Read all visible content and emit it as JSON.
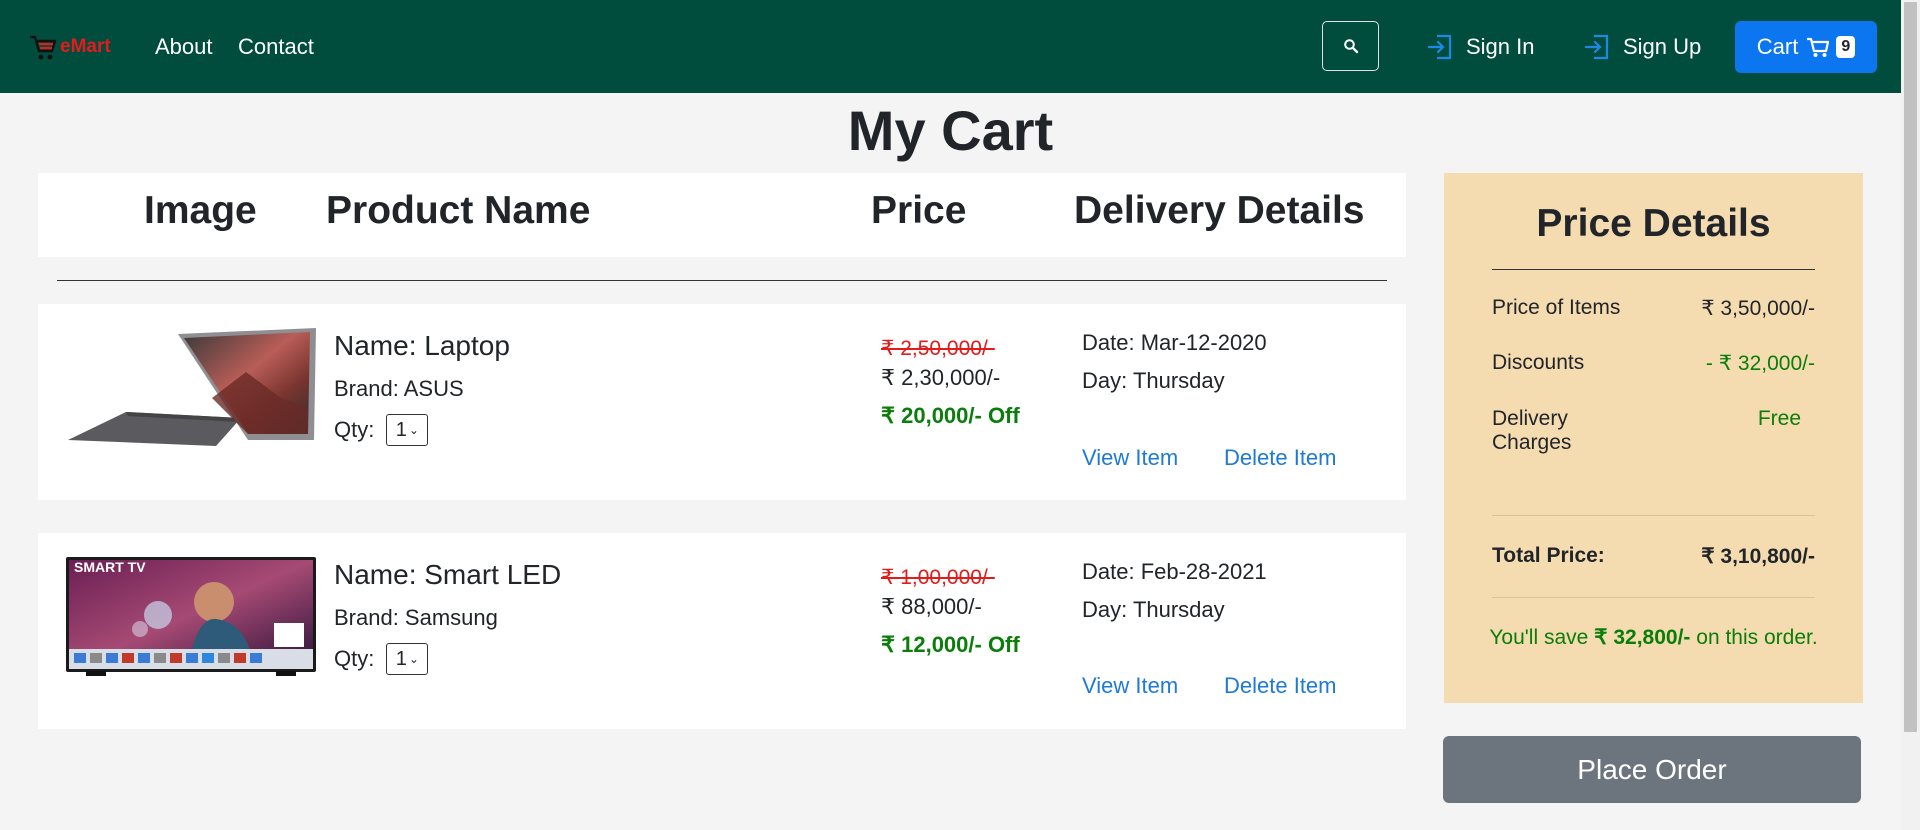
{
  "nav": {
    "brand": "eMart",
    "links": [
      "About",
      "Contact"
    ],
    "sign_in": "Sign In",
    "sign_up": "Sign Up",
    "cart_label": "Cart",
    "cart_count": "9"
  },
  "page": {
    "title": "My Cart"
  },
  "table_headers": [
    "Image",
    "Product Name",
    "Price",
    "Delivery Details"
  ],
  "items": [
    {
      "name": "Name: Laptop",
      "brand": "Brand: ASUS",
      "qty_label": "Qty:",
      "qty": "1",
      "original_price": "₹ 2,50,000/-",
      "price": "₹ 2,30,000/-",
      "off": "₹ 20,000/- Off",
      "date": "Date: Mar-12-2020",
      "day": "Day: Thursday",
      "view": "View Item",
      "delete": "Delete Item",
      "image_icon": "laptop-icon"
    },
    {
      "name": "Name: Smart LED",
      "brand": "Brand: Samsung",
      "qty_label": "Qty:",
      "qty": "1",
      "original_price": "₹ 1,00,000/-",
      "price": "₹ 88,000/-",
      "off": "₹ 12,000/- Off",
      "date": "Date: Feb-28-2021",
      "day": "Day: Thursday",
      "view": "View Item",
      "delete": "Delete Item",
      "image_label": "SMART TV",
      "image_icon": "smart-tv-icon"
    }
  ],
  "price_details": {
    "title": "Price Details",
    "items_label": "Price of Items",
    "items_value": "₹ 3,50,000/-",
    "discount_label": "Discounts",
    "discount_value": "- ₹ 32,000/-",
    "delivery_label_1": "Delivery",
    "delivery_label_2": "Charges",
    "delivery_value": "Free",
    "total_label": "Total Price:",
    "total_value": "₹ 3,10,800/-",
    "save_prefix": "You'll save",
    "save_amount": "₹ 32,800/-",
    "save_suffix": "on this order."
  },
  "place_order": "Place Order",
  "colors": {
    "navbar": "#004d3d",
    "cart_button": "#0b76ef",
    "price_box": "#f5dcb0",
    "strike_red": "#e21b1b",
    "discount_green": "#0a7d0a",
    "link_blue": "#1e7ad6",
    "place_order": "#6c757d"
  }
}
